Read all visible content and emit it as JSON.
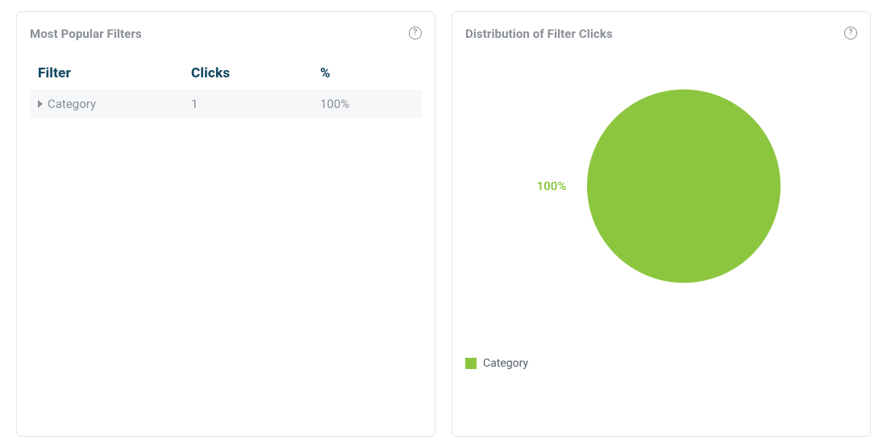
{
  "panels": {
    "filters": {
      "title": "Most Popular Filters",
      "columns": {
        "filter": "Filter",
        "clicks": "Clicks",
        "pct": "%"
      },
      "rows": [
        {
          "name": "Category",
          "clicks": "1",
          "pct": "100%"
        }
      ]
    },
    "distribution": {
      "title": "Distribution of Filter Clicks",
      "legend": [
        {
          "label": "Category"
        }
      ],
      "slice_label": "100%"
    }
  },
  "chart_data": {
    "type": "pie",
    "title": "Distribution of Filter Clicks",
    "categories": [
      "Category"
    ],
    "values": [
      100
    ],
    "series": [
      {
        "name": "Category",
        "values": [
          100
        ]
      }
    ],
    "colors": {
      "Category": "#8cc63f"
    }
  }
}
